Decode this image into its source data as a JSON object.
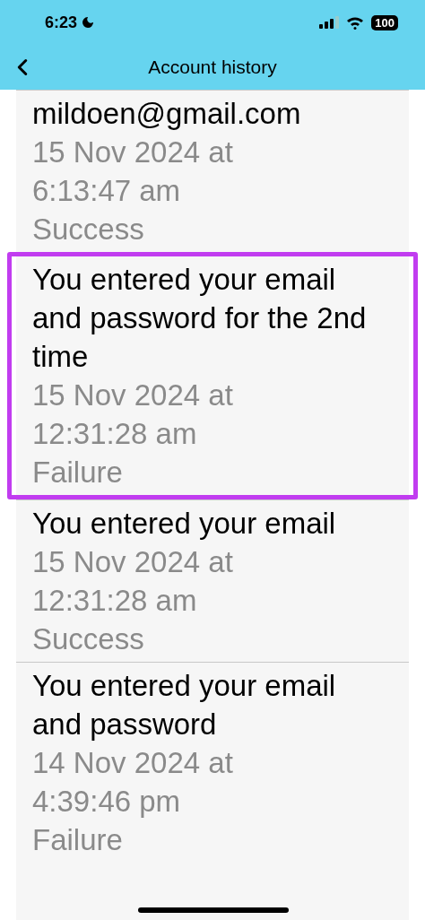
{
  "status_bar": {
    "time": "6:23",
    "battery": "100"
  },
  "header": {
    "title": "Account history"
  },
  "entries": [
    {
      "title": "mildoen@gmail.com",
      "date": "15 Nov 2024 at",
      "time": "6:13:47 am",
      "result": "Success",
      "highlighted": false
    },
    {
      "title": "You entered your email and password for the 2nd time",
      "date": "15 Nov 2024 at",
      "time": "12:31:28 am",
      "result": "Failure",
      "highlighted": true
    },
    {
      "title": "You entered your email",
      "date": "15 Nov 2024 at",
      "time": "12:31:28 am",
      "result": "Success",
      "highlighted": false
    },
    {
      "title": "You entered your email and password",
      "date": "14 Nov 2024 at",
      "time": "4:39:46 pm",
      "result": "Failure",
      "highlighted": false
    }
  ]
}
